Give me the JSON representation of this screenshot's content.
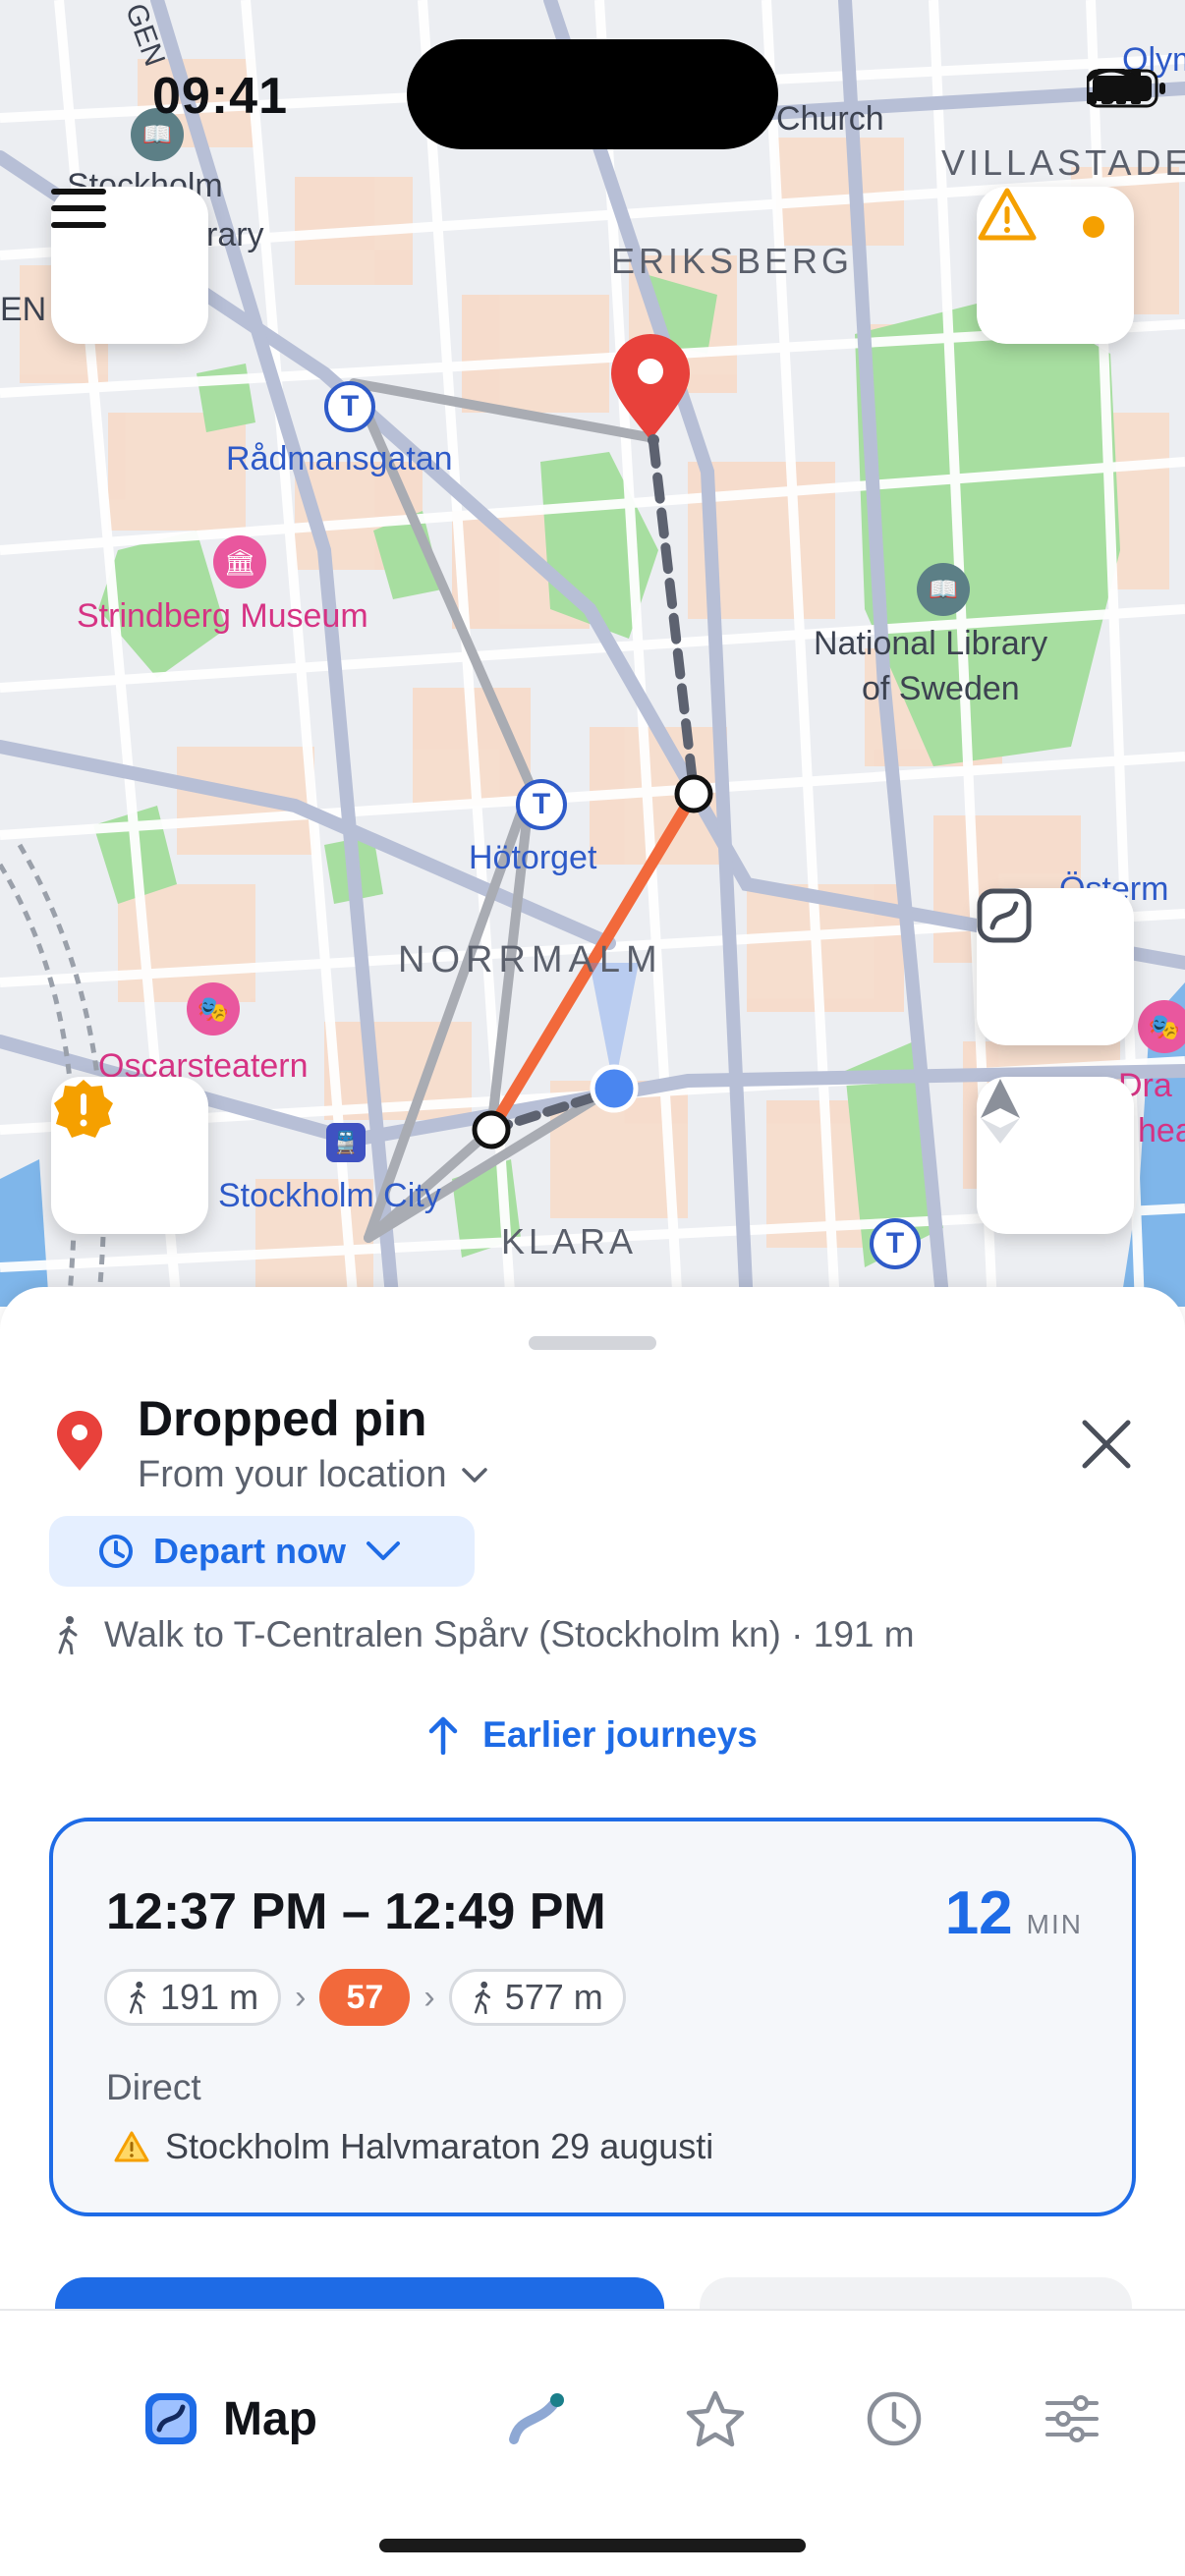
{
  "status_bar": {
    "time": "09:41"
  },
  "map": {
    "labels": {
      "eriksberg": "ERIKSBERG",
      "villastaden": "VILLASTADEN",
      "church": "Church",
      "olym": "Olym",
      "stockholm_library_1": "Stockholm",
      "stockholm_library_2": "rary",
      "radmansgatan": "Rådmansgatan",
      "strindberg": "Strindberg Museum",
      "national_library_1": "National Library",
      "national_library_2": "of Sweden",
      "hotorget": "Hötorget",
      "norrmalm": "NORRMALM",
      "osterm": "Österm",
      "oscarsteatern": "Oscarsteatern",
      "stockholm_city": "Stockholm City",
      "klara": "KLARA",
      "royal_dra": "Dra",
      "royal_heat": "heat",
      "left_en": "EN",
      "gen": "GEN"
    }
  },
  "colors": {
    "accent": "#1e6be6",
    "route_bus": "#f2693b",
    "pin": "#e8413b",
    "warning": "#f5a000"
  },
  "sheet": {
    "title": "Dropped pin",
    "subtitle": "From your location",
    "depart_label": "Depart now",
    "walk_info": "Walk to T-Centralen Spårv (Stockholm kn) · 191 m",
    "earlier_label": "Earlier journeys",
    "journey": {
      "time_range": "12:37 PM – 12:49 PM",
      "duration": "12",
      "duration_unit": "MIN",
      "legs": {
        "walk1": "191 m",
        "line": "57",
        "walk2": "577 m"
      },
      "type": "Direct",
      "warning": "Stockholm Halvmaraton 29 augusti"
    }
  },
  "tabbar": {
    "map_label": "Map",
    "tabs": [
      "map-tab",
      "journeys-tab",
      "favorites-tab",
      "history-tab",
      "settings-tab"
    ]
  },
  "icons": [
    "menu-icon",
    "alert-icon",
    "report-icon",
    "route-overview-icon",
    "compass-icon",
    "pin-icon",
    "close-icon",
    "clock-icon",
    "chevron-down-icon",
    "walk-icon",
    "arrow-up-icon",
    "warning-icon",
    "star-icon",
    "history-icon",
    "sliders-icon"
  ]
}
